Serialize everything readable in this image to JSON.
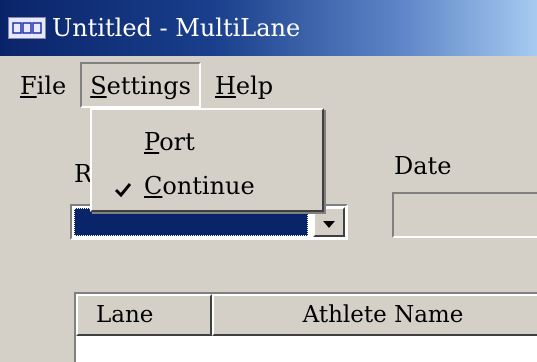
{
  "window": {
    "title": "Untitled - MultiLane",
    "icon": "app-icon"
  },
  "menubar": {
    "items": [
      {
        "label": "File",
        "mnemonic": "F",
        "rest": "ile"
      },
      {
        "label": "Settings",
        "mnemonic": "S",
        "rest": "ettings"
      },
      {
        "label": "Help",
        "mnemonic": "H",
        "rest": "elp"
      }
    ]
  },
  "settings_menu": {
    "items": [
      {
        "label": "Port",
        "mnemonic": "P",
        "rest": "ort",
        "checked": false
      },
      {
        "label": "Continue",
        "mnemonic": "C",
        "rest": "ontinue",
        "checked": true
      }
    ]
  },
  "form": {
    "race_label_partial": "R",
    "date_label": "Date",
    "date_value": ""
  },
  "grid": {
    "columns": [
      "Lane",
      "Athlete Name"
    ]
  },
  "icons": {
    "combo_button": "chevron-down-icon",
    "check": "check-icon"
  },
  "colors": {
    "titlebar_start": "#0a246a",
    "titlebar_end": "#a6caf0",
    "face": "#d4d0c8",
    "selection": "#0a246a"
  }
}
